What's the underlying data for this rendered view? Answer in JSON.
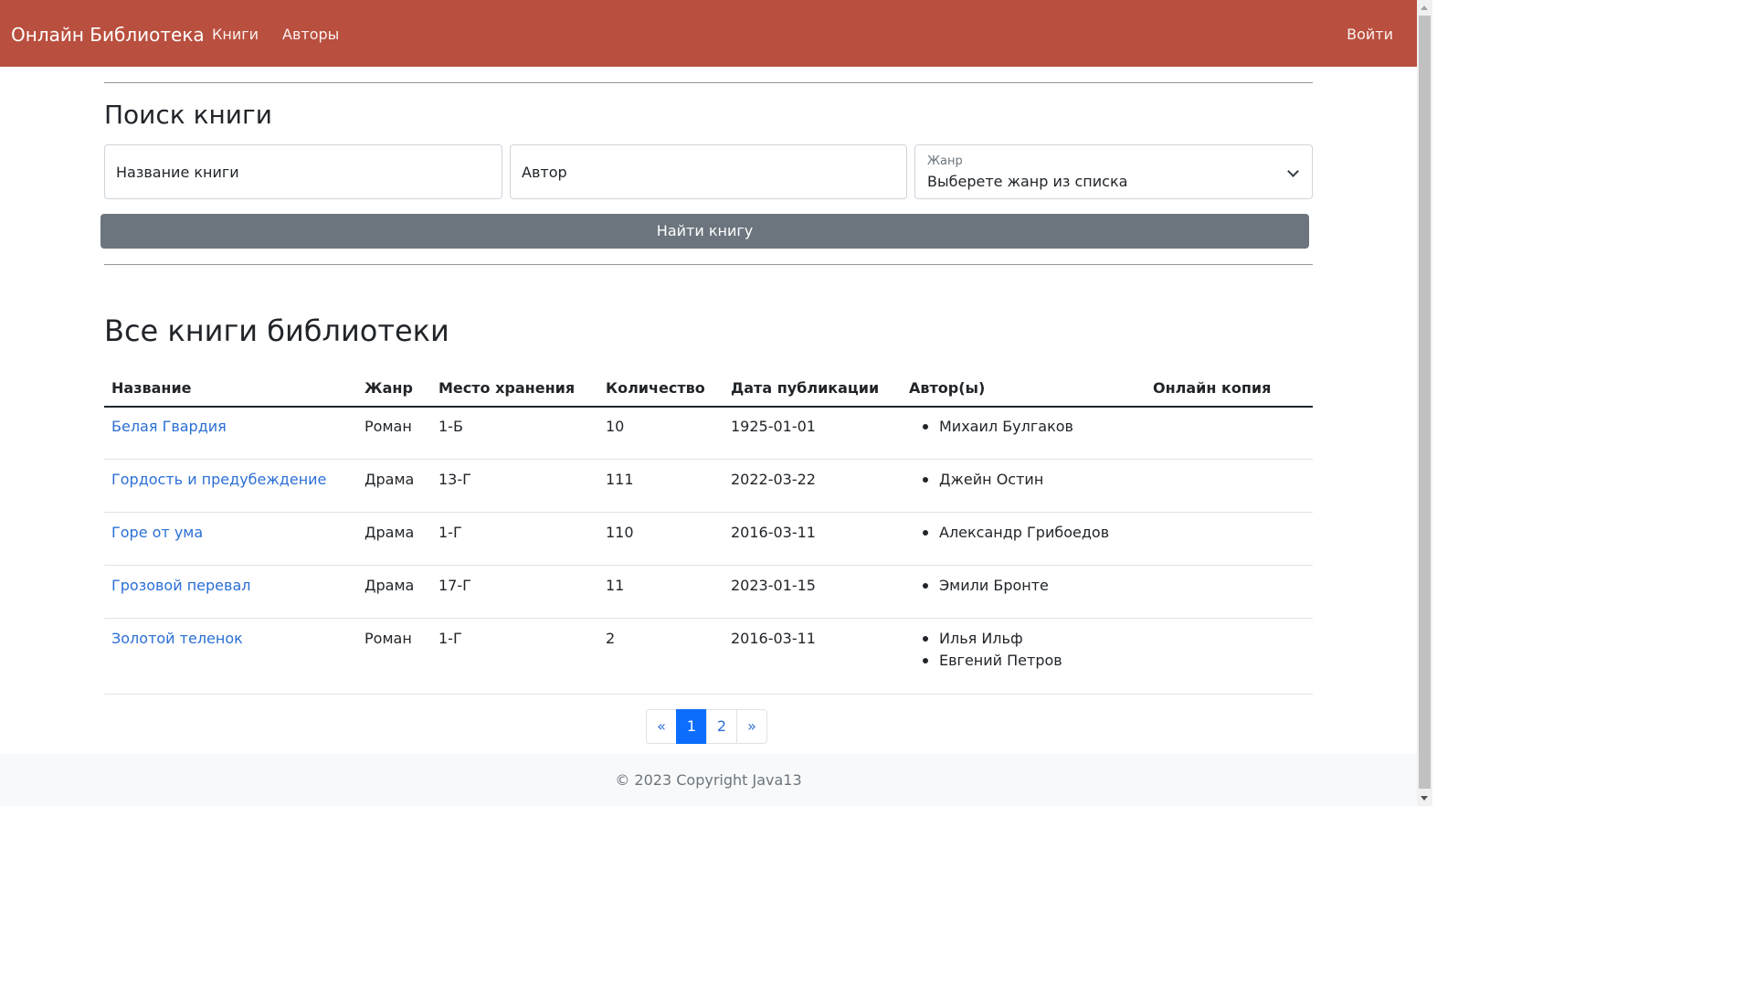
{
  "navbar": {
    "brand": "Онлайн Библиотека",
    "links": [
      "Книги",
      "Авторы"
    ],
    "login": "Войти"
  },
  "search": {
    "title": "Поиск книги",
    "title_placeholder": "Название книги",
    "author_placeholder": "Автор",
    "genre_label": "Жанр",
    "genre_value": "Выберете жанр из списка",
    "submit": "Найти книгу"
  },
  "books": {
    "title": "Все книги библиотеки",
    "columns": [
      "Название",
      "Жанр",
      "Место хранения",
      "Количество",
      "Дата публикации",
      "Автор(ы)",
      "Онлайн копия"
    ],
    "rows": [
      {
        "name": "Белая Гвардия",
        "genre": "Роман",
        "place": "1-Б",
        "count": "10",
        "date": "1925-01-01",
        "authors": [
          "Михаил Булгаков"
        ],
        "online": ""
      },
      {
        "name": "Гордость и предубеждение",
        "genre": "Драма",
        "place": "13-Г",
        "count": "111",
        "date": "2022-03-22",
        "authors": [
          "Джейн Остин"
        ],
        "online": ""
      },
      {
        "name": "Горе от ума",
        "genre": "Драма",
        "place": "1-Г",
        "count": "110",
        "date": "2016-03-11",
        "authors": [
          "Александр Грибоедов"
        ],
        "online": ""
      },
      {
        "name": "Грозовой перевал",
        "genre": "Драма",
        "place": "17-Г",
        "count": "11",
        "date": "2023-01-15",
        "authors": [
          "Эмили Бронте"
        ],
        "online": ""
      },
      {
        "name": "Золотой теленок",
        "genre": "Роман",
        "place": "1-Г",
        "count": "2",
        "date": "2016-03-11",
        "authors": [
          "Илья Ильф",
          "Евгений Петров"
        ],
        "online": ""
      }
    ]
  },
  "pagination": {
    "prev": "«",
    "pages": [
      "1",
      "2"
    ],
    "active_page": "1",
    "next": "»"
  },
  "footer": {
    "text": "© 2023 Copyright Java13"
  },
  "colors": {
    "navbar": "#b94f3e",
    "button": "#6c757d",
    "link": "#2b6fd6",
    "active_page": "#0d6efd"
  }
}
